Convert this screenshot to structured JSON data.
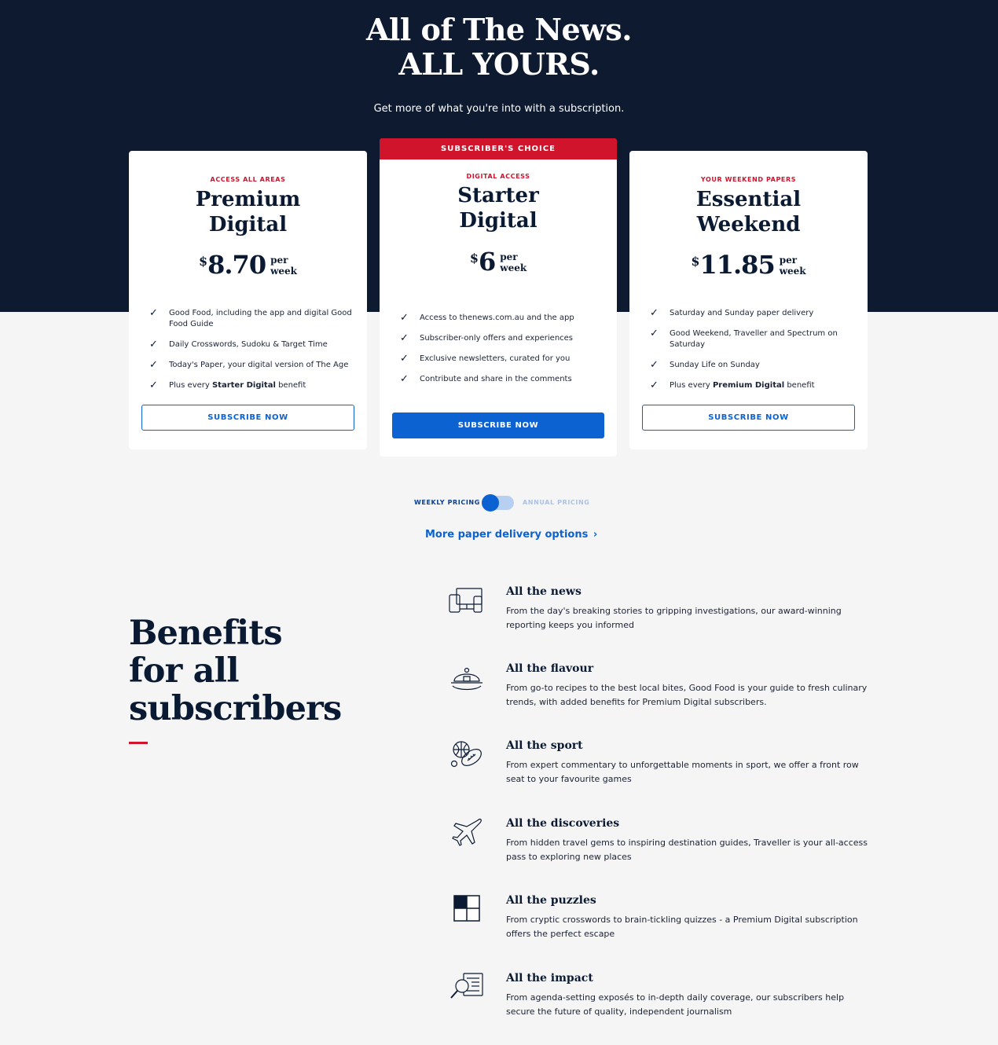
{
  "hero": {
    "title_line1": "All of The News.",
    "title_line2": "ALL YOURS.",
    "subtitle": "Get more of what you're into with a subscription."
  },
  "plans": [
    {
      "eyebrow": "ACCESS ALL AREAS",
      "name_line1": "Premium",
      "name_line2": "Digital",
      "currency": "$",
      "price": "8.70",
      "per": "per",
      "period": "week",
      "features": [
        "Good Food, including the app and digital Good Food Guide",
        "Daily Crosswords, Sudoku & Target Time",
        "Today's Paper, your digital version of The Age"
      ],
      "last_feature": {
        "prefix": "Plus every ",
        "bold": "Starter Digital",
        "suffix": " benefit"
      },
      "button": "SUBSCRIBE NOW"
    },
    {
      "ribbon": "SUBSCRIBER'S CHOICE",
      "eyebrow": "DIGITAL ACCESS",
      "name_line1": "Starter",
      "name_line2": "Digital",
      "currency": "$",
      "price": "6",
      "per": "per",
      "period": "week",
      "features": [
        "Access to thenews.com.au and the app",
        "Subscriber-only offers and experiences",
        "Exclusive newsletters, curated for you",
        "Contribute and share in the comments"
      ],
      "button": "SUBSCRIBE NOW"
    },
    {
      "eyebrow": "YOUR WEEKEND PAPERS",
      "name_line1": "Essential",
      "name_line2": "Weekend",
      "currency": "$",
      "price": "11.85",
      "per": "per",
      "period": "week",
      "features": [
        "Saturday and Sunday paper delivery",
        "Good Weekend, Traveller and Spectrum on Saturday",
        "Sunday Life on Sunday"
      ],
      "last_feature": {
        "prefix": "Plus every ",
        "bold": "Premium Digital",
        "suffix": " benefit"
      },
      "button": "SUBSCRIBE NOW"
    }
  ],
  "pricing_toggle": {
    "weekly_label": "WEEKLY PRICING",
    "annual_label": "ANNUAL PRICING",
    "selected": "weekly"
  },
  "more_link": "More paper delivery options",
  "benefits": {
    "title_lines": [
      "Benefits",
      "for all",
      "subscribers"
    ],
    "items": [
      {
        "icon": "devices-icon",
        "title": "All the news",
        "desc": "From the day's breaking stories to gripping investigations, our award-winning reporting keeps you informed"
      },
      {
        "icon": "cloche-icon",
        "title": "All the flavour",
        "desc": "From go-to recipes to the best local bites, Good Food is your guide to fresh culinary trends, with added benefits for Premium Digital subscribers."
      },
      {
        "icon": "sports-balls-icon",
        "title": "All the sport",
        "desc": "From expert commentary to unforgettable moments in sport, we offer a front row seat to your favourite games"
      },
      {
        "icon": "airplane-icon",
        "title": "All the discoveries",
        "desc": "From hidden travel gems to inspiring destination guides, Traveller is your all-access pass to exploring new places"
      },
      {
        "icon": "crossword-icon",
        "title": "All the puzzles",
        "desc": "From cryptic crosswords to brain-tickling quizzes - a Premium Digital subscription offers the perfect escape"
      },
      {
        "icon": "magnify-document-icon",
        "title": "All the impact",
        "desc": "From agenda-setting exposés to in-depth daily coverage, our subscribers help secure the future of quality, independent journalism"
      }
    ]
  },
  "colors": {
    "navy": "#0e1a30",
    "red": "#d0142c",
    "blue": "#0c62d1"
  }
}
